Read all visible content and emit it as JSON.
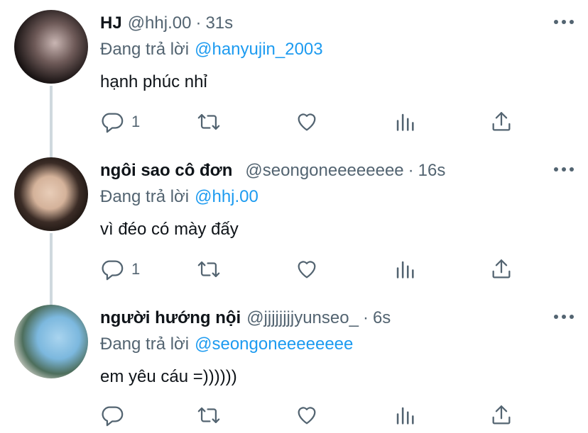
{
  "tweets": [
    {
      "name": "HJ",
      "handle": "@hhj.00",
      "separator": "·",
      "time": "31s",
      "reply_prefix": "Đang trả lời",
      "reply_to": "@hanyujin_2003",
      "text": "hạnh phúc nhỉ",
      "reply_count": "1"
    },
    {
      "name": "ngôi sao cô đơn",
      "handle": "@seongoneeeeeeee",
      "separator": "·",
      "time": "16s",
      "reply_prefix": "Đang trả lời",
      "reply_to": "@hhj.00",
      "text": "vì đéo có mày đấy",
      "reply_count": "1"
    },
    {
      "name": "người hướng nội",
      "handle": "@jjjjjjjjyunseo_",
      "separator": "·",
      "time": "6s",
      "reply_prefix": "Đang trả lời",
      "reply_to": "@seongoneeeeeeee",
      "text": "em yêu cáu =))))))",
      "reply_count": ""
    }
  ],
  "icons": {
    "more": "more-icon",
    "reply": "reply-icon",
    "retweet": "retweet-icon",
    "like": "heart-icon",
    "stats": "stats-icon",
    "share": "share-icon"
  },
  "colors": {
    "accent": "#1d9bf0",
    "secondary_text": "#536471",
    "thread_line": "#cfd9de"
  }
}
